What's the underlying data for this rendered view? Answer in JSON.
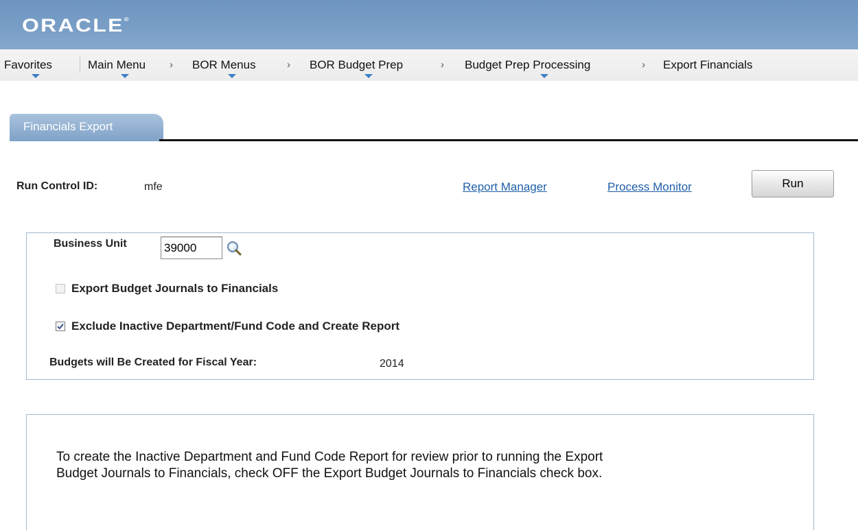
{
  "header": {
    "logo": "ORACLE",
    "logo_mark": "®"
  },
  "breadcrumb": {
    "items": [
      {
        "label": "Favorites",
        "has_menu": true
      },
      {
        "label": "Main Menu",
        "has_menu": true
      },
      {
        "label": "BOR Menus",
        "has_menu": true
      },
      {
        "label": "BOR Budget Prep",
        "has_menu": true
      },
      {
        "label": "Budget Prep Processing",
        "has_menu": true
      },
      {
        "label": "Export Financials",
        "has_menu": false
      }
    ],
    "separator": "›"
  },
  "tabs": [
    {
      "label": "Financials Export",
      "active": true
    }
  ],
  "run_control": {
    "label": "Run Control ID:",
    "value": "mfe",
    "report_manager_link": "Report Manager",
    "process_monitor_link": "Process Monitor",
    "run_button": "Run"
  },
  "form": {
    "business_unit_label": "Business Unit",
    "business_unit_value": "39000",
    "lookup_icon": "magnifier-lookup-icon",
    "export_journals": {
      "label": "Export Budget Journals to Financials",
      "checked": false,
      "disabled": true
    },
    "exclude_inactive": {
      "label": "Exclude Inactive Department/Fund Code and Create Report",
      "checked": true,
      "disabled": false
    },
    "fiscal_year_label": "Budgets will Be Created for Fiscal Year:",
    "fiscal_year_value": "2014"
  },
  "info": {
    "line1": "To create the Inactive Department and Fund Code Report for review prior to running the Export",
    "line2": "Budget Journals to Financials, check OFF the Export Budget Journals to Financials check box."
  },
  "colors": {
    "banner": "#7a9fc7",
    "link": "#1f5fa8",
    "tab": "#8fb0d3",
    "menu_arrow": "#3d7fc6",
    "box_border": "#9fb7cf"
  }
}
